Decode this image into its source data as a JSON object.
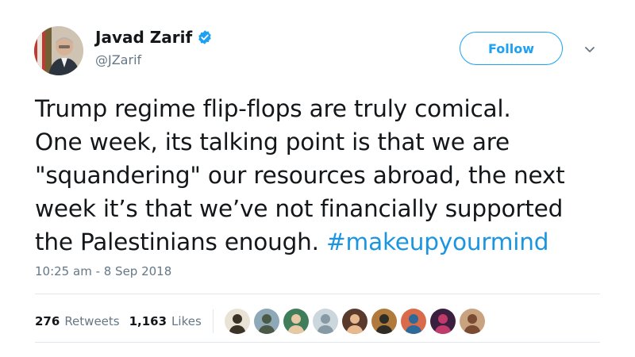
{
  "author": {
    "display_name": "Javad Zarif",
    "handle": "@JZarif",
    "verified": true,
    "avatar_icon": "profile-photo"
  },
  "actions": {
    "follow_label": "Follow",
    "more_icon": "chevron-down-icon"
  },
  "tweet": {
    "lines": [
      "Trump regime flip-flops are truly comical.",
      "One week, its talking point is that we are",
      "\"squandering\" our resources abroad, the next",
      "week it’s that we’ve not financially supported",
      "the Palestinians enough."
    ],
    "hashtag": "#makeupyourmind",
    "timestamp": "10:25 am - 8 Sep 2018"
  },
  "stats": {
    "retweets_count": "276",
    "retweets_label": "Retweets",
    "likes_count": "1,163",
    "likes_label": "Likes"
  },
  "likers": [
    {
      "name": "liker-avatar-1",
      "bg": "#e9e3d6",
      "fg": "#3a3326"
    },
    {
      "name": "liker-avatar-2",
      "bg": "#8fa8b8",
      "fg": "#4b5a46"
    },
    {
      "name": "liker-avatar-3",
      "bg": "#3f7d5b",
      "fg": "#e8c9a6"
    },
    {
      "name": "liker-avatar-4",
      "bg": "#ccd6dd",
      "fg": "#8899a6"
    },
    {
      "name": "liker-avatar-5",
      "bg": "#5b3a2e",
      "fg": "#e8b98e"
    },
    {
      "name": "liker-avatar-6",
      "bg": "#b07a3c",
      "fg": "#2f2b25"
    },
    {
      "name": "liker-avatar-7",
      "bg": "#d96a4a",
      "fg": "#2d6a9a"
    },
    {
      "name": "liker-avatar-8",
      "bg": "#3b1f3f",
      "fg": "#c03a6a"
    },
    {
      "name": "liker-avatar-9",
      "bg": "#c9a27f",
      "fg": "#7a4a33"
    }
  ],
  "colors": {
    "accent": "#1da1f2",
    "hashtag": "#1b95e0",
    "secondary_text": "#657786",
    "divider": "#e1e8ed"
  }
}
